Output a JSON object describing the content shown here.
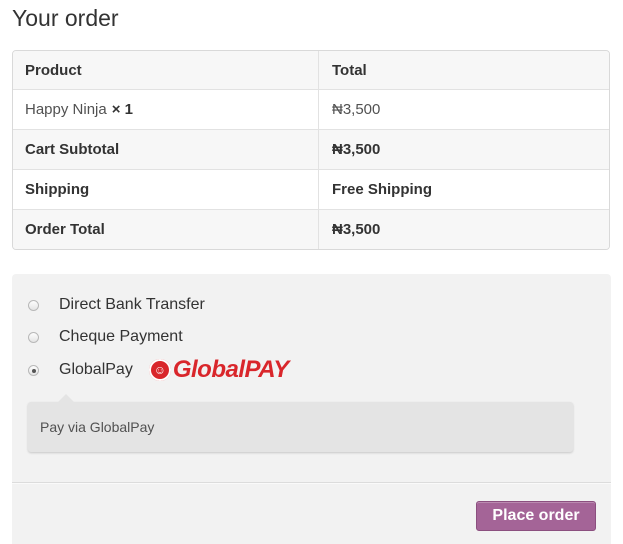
{
  "title": "Your order",
  "table": {
    "headers": {
      "product": "Product",
      "total": "Total"
    },
    "item": {
      "name": "Happy Ninja",
      "qty": "× 1",
      "total": "₦3,500"
    },
    "rows": [
      {
        "label": "Cart Subtotal",
        "value": "₦3,500"
      },
      {
        "label": "Shipping",
        "value": "Free Shipping"
      },
      {
        "label": "Order Total",
        "value": "₦3,500"
      }
    ]
  },
  "payment": {
    "methods": [
      {
        "label": "Direct Bank Transfer",
        "checked": false
      },
      {
        "label": "Cheque Payment",
        "checked": false
      },
      {
        "label": "GlobalPay",
        "checked": true
      }
    ],
    "logo_text": "GlobalPAY",
    "description": "Pay via GlobalPay",
    "place_order": "Place order"
  },
  "colors": {
    "button": "#a46497",
    "logo": "#d9262b"
  }
}
